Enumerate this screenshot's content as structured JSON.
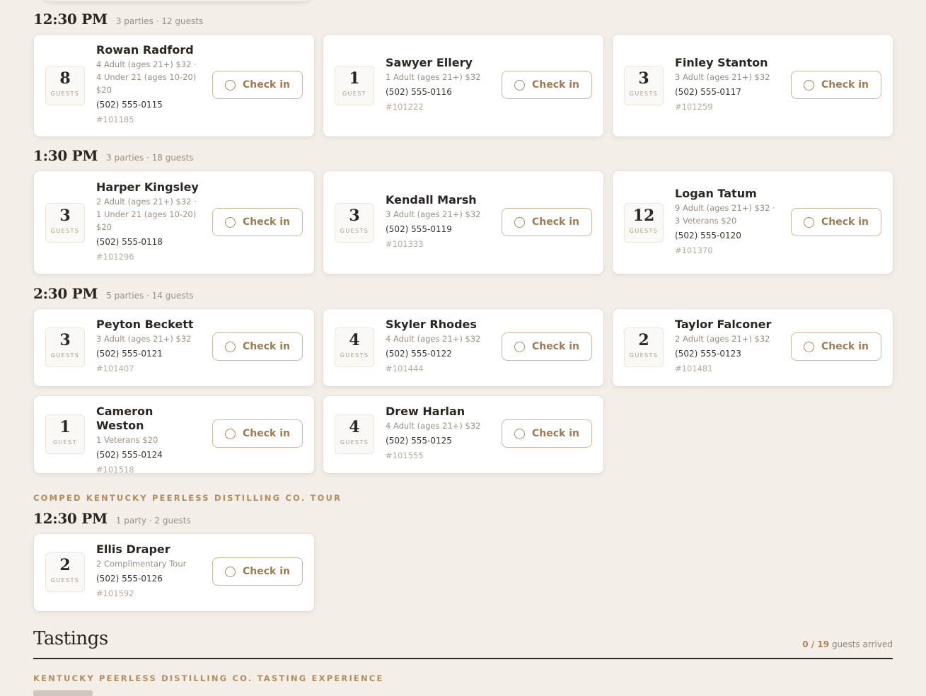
{
  "groups": [
    {
      "slots": [
        {
          "time": "12:30 PM",
          "meta": "3 parties · 12 guests",
          "cards": [
            {
              "name": "Rowan Radford",
              "count": "8",
              "unit": "GUESTS",
              "tickets": "4 Adult (ages 21+) $32 · 4 Under 21 (ages 10-20) $20",
              "phone": "(502) 555-0115",
              "order": "#101185"
            },
            {
              "name": "Sawyer Ellery",
              "count": "1",
              "unit": "GUEST",
              "tickets": "1 Adult (ages 21+) $32",
              "phone": "(502) 555-0116",
              "order": "#101222"
            },
            {
              "name": "Finley Stanton",
              "count": "3",
              "unit": "GUESTS",
              "tickets": "3 Adult (ages 21+) $32",
              "phone": "(502) 555-0117",
              "order": "#101259"
            }
          ]
        },
        {
          "time": "1:30 PM",
          "meta": "3 parties · 18 guests",
          "cards": [
            {
              "name": "Harper Kingsley",
              "count": "3",
              "unit": "GUESTS",
              "tickets": "2 Adult (ages 21+) $32 · 1 Under 21 (ages 10-20) $20",
              "phone": "(502) 555-0118",
              "order": "#101296"
            },
            {
              "name": "Kendall Marsh",
              "count": "3",
              "unit": "GUESTS",
              "tickets": "3 Adult (ages 21+) $32",
              "phone": "(502) 555-0119",
              "order": "#101333"
            },
            {
              "name": "Logan Tatum",
              "count": "12",
              "unit": "GUESTS",
              "tickets": "9 Adult (ages 21+) $32 · 3 Veterans $20",
              "phone": "(502) 555-0120",
              "order": "#101370"
            }
          ]
        },
        {
          "time": "2:30 PM",
          "meta": "5 parties · 14 guests",
          "cards": [
            {
              "name": "Peyton Beckett",
              "count": "3",
              "unit": "GUESTS",
              "tickets": "3 Adult (ages 21+) $32",
              "phone": "(502) 555-0121",
              "order": "#101407"
            },
            {
              "name": "Skyler Rhodes",
              "count": "4",
              "unit": "GUESTS",
              "tickets": "4 Adult (ages 21+) $32",
              "phone": "(502) 555-0122",
              "order": "#101444"
            },
            {
              "name": "Taylor Falconer",
              "count": "2",
              "unit": "GUESTS",
              "tickets": "2 Adult (ages 21+) $32",
              "phone": "(502) 555-0123",
              "order": "#101481"
            },
            {
              "name": "Cameron Weston",
              "count": "1",
              "unit": "GUEST",
              "tickets": "1 Veterans $20",
              "phone": "(502) 555-0124",
              "order": "#101518"
            },
            {
              "name": "Drew Harlan",
              "count": "4",
              "unit": "GUESTS",
              "tickets": "4 Adult (ages 21+) $32",
              "phone": "(502) 555-0125",
              "order": "#101555"
            }
          ]
        }
      ]
    },
    {
      "label": "COMPED KENTUCKY PEERLESS DISTILLING CO. TOUR",
      "slots": [
        {
          "time": "12:30 PM",
          "meta": "1 party · 2 guests",
          "cards": [
            {
              "name": "Ellis Draper",
              "count": "2",
              "unit": "GUESTS",
              "tickets": "2 Complimentary Tour",
              "phone": "(502) 555-0126",
              "order": "#101592"
            }
          ]
        }
      ]
    }
  ],
  "check_in_label": "Check in",
  "tastings": {
    "title": "Tastings",
    "arrived_count": "0 / 19",
    "arrived_label": "guests arrived",
    "section_label": "KENTUCKY PEERLESS DISTILLING CO. TASTING EXPERIENCE"
  },
  "colors": {
    "accent": "#9b7c55",
    "background": "#f3eee7",
    "card": "#ffffff"
  }
}
